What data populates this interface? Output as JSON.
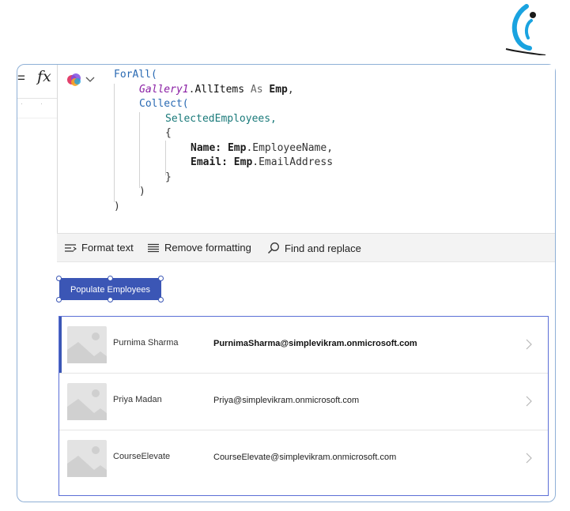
{
  "formula_bar": {
    "equals": "=",
    "fx": "fx",
    "code_lines": [
      "ForAll(",
      "Gallery1.AllItems As Emp,",
      "Collect(",
      "SelectedEmployees,",
      "{",
      "Name: Emp.EmployeeName,",
      "Email: Emp.EmailAddress",
      "}",
      ")",
      ")"
    ]
  },
  "toolbar": {
    "format_text": "Format text",
    "remove_formatting": "Remove formatting",
    "find_replace": "Find and replace"
  },
  "populate_button": {
    "label": "Populate Employees"
  },
  "gallery": {
    "rows": [
      {
        "name": "Purnima Sharma",
        "email": "PurnimaSharma@simplevikram.onmicrosoft.com",
        "selected": true
      },
      {
        "name": "Priya Madan",
        "email": "Priya@simplevikram.onmicrosoft.com",
        "selected": false
      },
      {
        "name": "CourseElevate",
        "email": "CourseElevate@simplevikram.onmicrosoft.com",
        "selected": false
      }
    ]
  },
  "colors": {
    "accent": "#3b56b5",
    "keyword": "#2a6ab3",
    "gallery_ref": "#8a1fa4",
    "collection": "#1a7a7a"
  },
  "icons": [
    "logo-icon",
    "copilot-icon",
    "chevron-down-icon",
    "format-text-icon",
    "remove-formatting-icon",
    "search-icon",
    "image-placeholder-icon",
    "chevron-right-icon"
  ]
}
